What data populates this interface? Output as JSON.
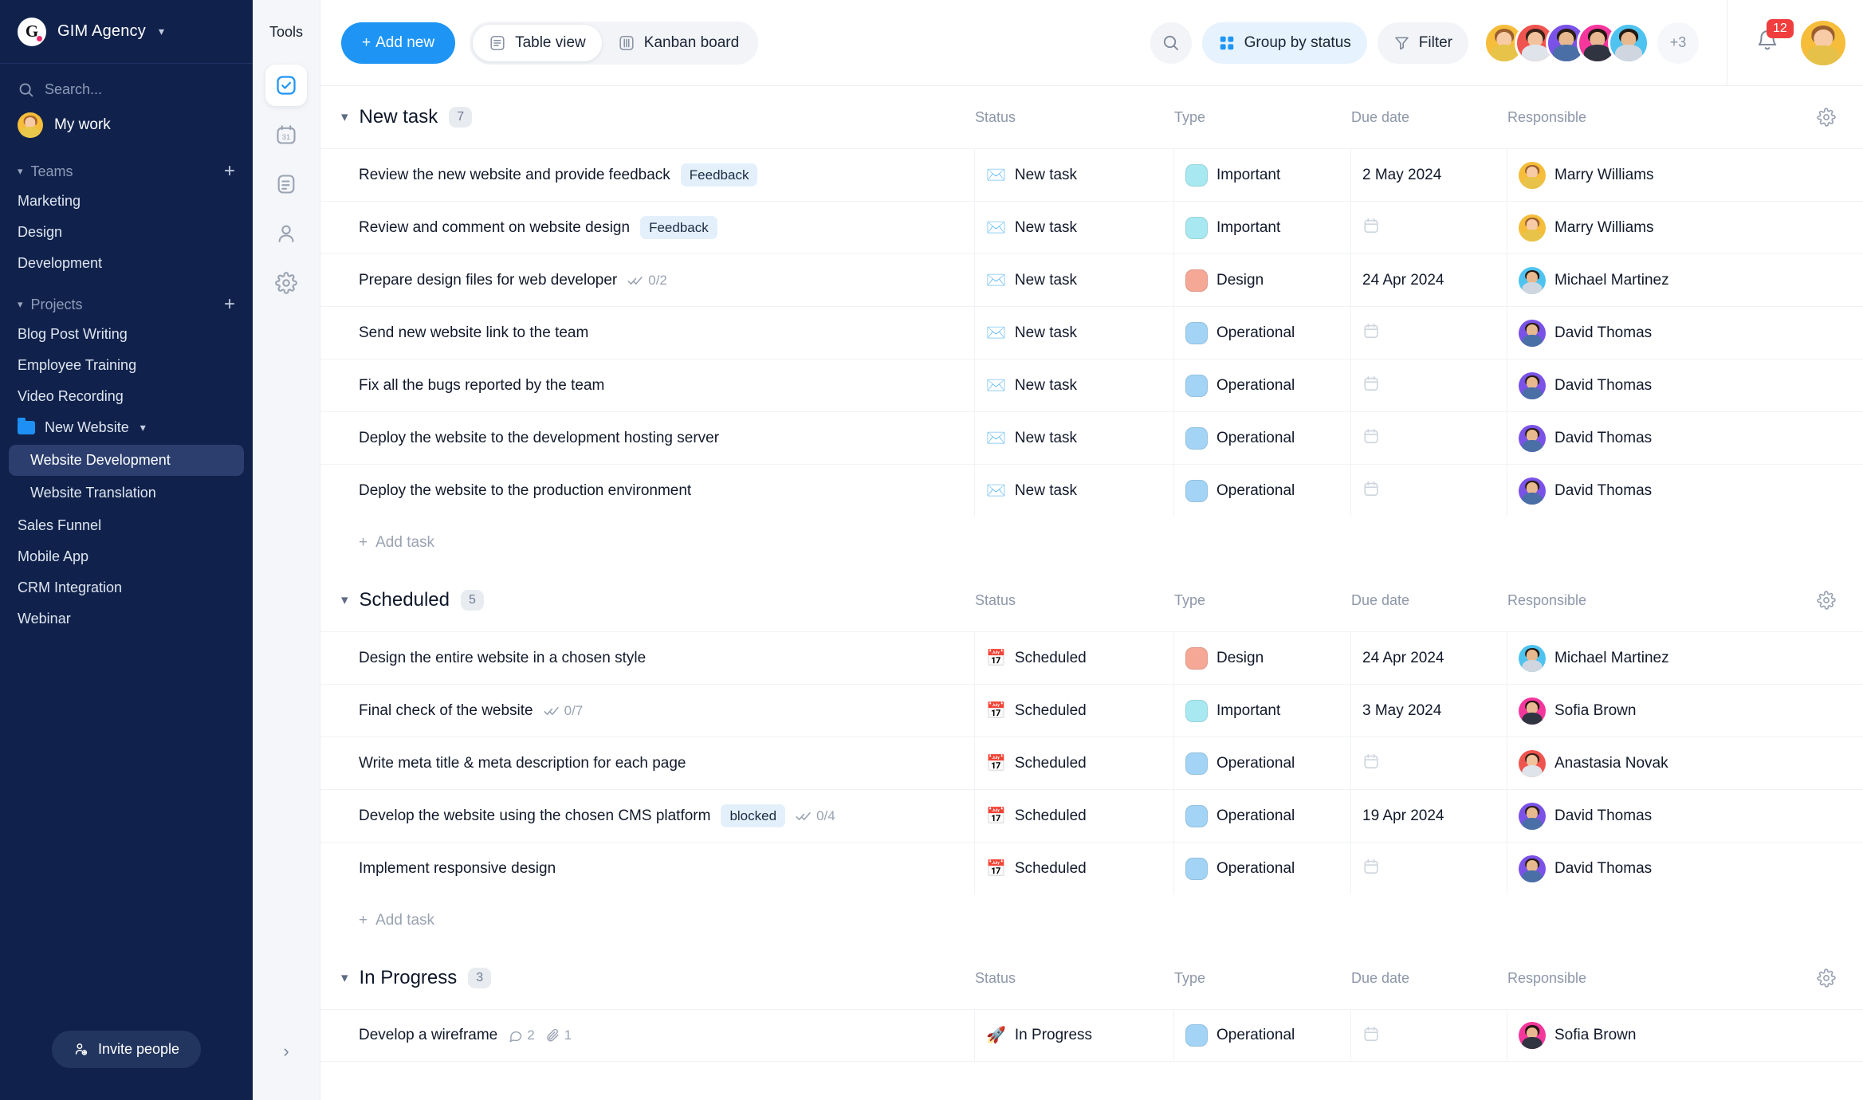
{
  "sidebar": {
    "brand": {
      "logo_letter": "G",
      "name": "GIM Agency",
      "caret_icon": "chevron-down-icon"
    },
    "search": {
      "placeholder": "Search...",
      "value": "",
      "icon": "search-icon"
    },
    "my_work": {
      "label": "My work"
    },
    "teams": {
      "title": "Teams",
      "add_icon": "plus-icon",
      "items": [
        {
          "label": "Marketing"
        },
        {
          "label": "Design"
        },
        {
          "label": "Development"
        }
      ]
    },
    "projects": {
      "title": "Projects",
      "add_icon": "plus-icon",
      "items": [
        {
          "label": "Blog Post Writing",
          "type": "plain"
        },
        {
          "label": "Employee Training",
          "type": "plain"
        },
        {
          "label": "Video Recording",
          "type": "plain"
        },
        {
          "label": "New Website",
          "type": "folder",
          "expanded": true,
          "folder_color": "#1e90f5"
        },
        {
          "label": "Website Development",
          "type": "child",
          "active": true
        },
        {
          "label": "Website Translation",
          "type": "child",
          "active": false
        },
        {
          "label": "Sales Funnel",
          "type": "plain"
        },
        {
          "label": "Mobile App",
          "type": "plain"
        },
        {
          "label": "CRM Integration",
          "type": "plain"
        },
        {
          "label": "Webinar",
          "type": "plain"
        }
      ]
    },
    "invite": {
      "label": "Invite people",
      "icon": "person-add-icon"
    }
  },
  "rail": {
    "title": "Tools",
    "items": [
      {
        "icon": "check-square-icon",
        "active": true
      },
      {
        "icon": "calendar-31-icon",
        "active": false
      },
      {
        "icon": "document-icon",
        "active": false
      },
      {
        "icon": "person-icon",
        "active": false
      },
      {
        "icon": "gear-icon",
        "active": false
      }
    ],
    "expand_icon": "chevron-right-icon"
  },
  "toolbar": {
    "add_new_label": "Add new",
    "table_view_label": "Table view",
    "kanban_board_label": "Kanban board",
    "active_view": "Table view",
    "search_icon": "search-icon",
    "group_by_label": "Group by status",
    "filter_label": "Filter",
    "avatars_overflow": "+3",
    "notification_count": "12",
    "accent_color": "#1e95f5"
  },
  "table": {
    "columns": [
      "Status",
      "Type",
      "Due date",
      "Responsible"
    ],
    "settings_icon": "gear-icon",
    "add_task_label": "Add task",
    "groups": [
      {
        "name": "New task",
        "count": "7",
        "rows": [
          {
            "name": "Review the new website and provide feedback",
            "tag": "Feedback",
            "subtasks": "",
            "status": "New task",
            "status_icon": "✉️",
            "type": "Important",
            "type_color": "#a8e8f0",
            "due": "2 May 2024",
            "responsible": "Marry Williams",
            "avatar": "marry"
          },
          {
            "name": "Review and comment on website design",
            "tag": "Feedback",
            "subtasks": "",
            "status": "New task",
            "status_icon": "✉️",
            "type": "Important",
            "type_color": "#a8e8f0",
            "due": "",
            "responsible": "Marry Williams",
            "avatar": "marry"
          },
          {
            "name": "Prepare design files for web developer",
            "tag": "",
            "subtasks": "0/2",
            "status": "New task",
            "status_icon": "✉️",
            "type": "Design",
            "type_color": "#f5a896",
            "due": "24 Apr 2024",
            "responsible": "Michael Martinez",
            "avatar": "michael"
          },
          {
            "name": "Send new website link to the team",
            "tag": "",
            "subtasks": "",
            "status": "New task",
            "status_icon": "✉️",
            "type": "Operational",
            "type_color": "#a3d4f5",
            "due": "",
            "responsible": "David Thomas",
            "avatar": "david"
          },
          {
            "name": "Fix all the bugs reported by the team",
            "tag": "",
            "subtasks": "",
            "status": "New task",
            "status_icon": "✉️",
            "type": "Operational",
            "type_color": "#a3d4f5",
            "due": "",
            "responsible": "David Thomas",
            "avatar": "david"
          },
          {
            "name": "Deploy the website to the development hosting server",
            "tag": "",
            "subtasks": "",
            "status": "New task",
            "status_icon": "✉️",
            "type": "Operational",
            "type_color": "#a3d4f5",
            "due": "",
            "responsible": "David Thomas",
            "avatar": "david"
          },
          {
            "name": "Deploy the website to the production environment",
            "tag": "",
            "subtasks": "",
            "status": "New task",
            "status_icon": "✉️",
            "type": "Operational",
            "type_color": "#a3d4f5",
            "due": "",
            "responsible": "David Thomas",
            "avatar": "david"
          }
        ]
      },
      {
        "name": "Scheduled",
        "count": "5",
        "rows": [
          {
            "name": "Design the entire website in a chosen style",
            "tag": "",
            "subtasks": "",
            "status": "Scheduled",
            "status_icon": "📅",
            "type": "Design",
            "type_color": "#f5a896",
            "due": "24 Apr 2024",
            "responsible": "Michael Martinez",
            "avatar": "michael"
          },
          {
            "name": "Final check of the website",
            "tag": "",
            "subtasks": "0/7",
            "status": "Scheduled",
            "status_icon": "📅",
            "type": "Important",
            "type_color": "#a8e8f0",
            "due": "3 May 2024",
            "responsible": "Sofia Brown",
            "avatar": "sofia"
          },
          {
            "name": "Write meta title & meta description for each page",
            "tag": "",
            "subtasks": "",
            "status": "Scheduled",
            "status_icon": "📅",
            "type": "Operational",
            "type_color": "#a3d4f5",
            "due": "",
            "responsible": "Anastasia Novak",
            "avatar": "anastasia"
          },
          {
            "name": "Develop the website using the chosen CMS platform",
            "tag": "blocked",
            "subtasks": "0/4",
            "status": "Scheduled",
            "status_icon": "📅",
            "type": "Operational",
            "type_color": "#a3d4f5",
            "due": "19 Apr 2024",
            "responsible": "David Thomas",
            "avatar": "david"
          },
          {
            "name": "Implement responsive design",
            "tag": "",
            "subtasks": "",
            "status": "Scheduled",
            "status_icon": "📅",
            "type": "Operational",
            "type_color": "#a3d4f5",
            "due": "",
            "responsible": "David Thomas",
            "avatar": "david"
          }
        ]
      },
      {
        "name": "In Progress",
        "count": "3",
        "rows": [
          {
            "name": "Develop a wireframe",
            "tag": "",
            "subtasks": "",
            "comments": "2",
            "attachments": "1",
            "status": "In Progress",
            "status_icon": "🚀",
            "type": "Operational",
            "type_color": "#a3d4f5",
            "due": "",
            "responsible": "Sofia Brown",
            "avatar": "sofia"
          }
        ]
      }
    ]
  }
}
